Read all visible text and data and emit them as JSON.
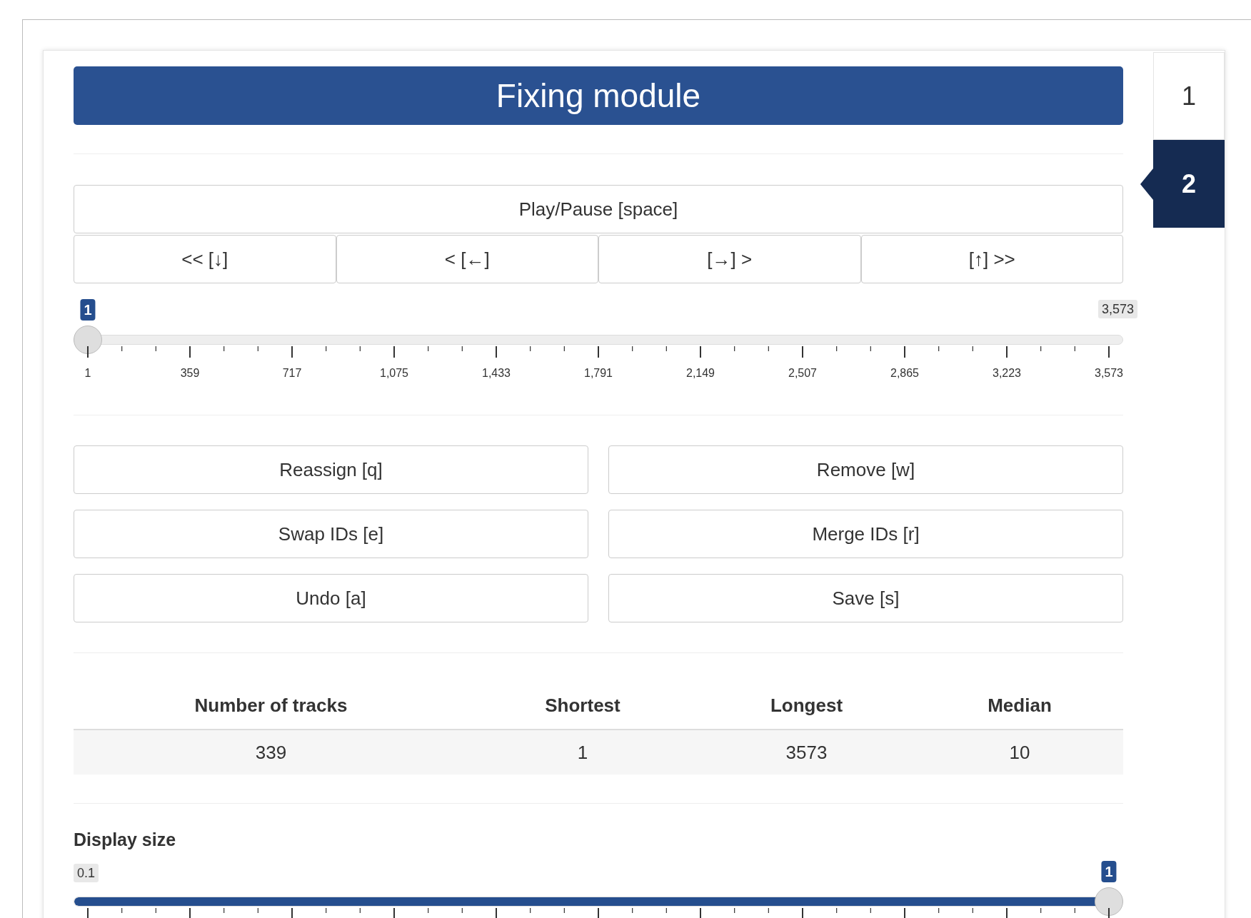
{
  "header": {
    "title": "Fixing module"
  },
  "tabs": [
    {
      "label": "1",
      "selected": false
    },
    {
      "label": "2",
      "selected": true
    }
  ],
  "playback": {
    "play_button": "Play/Pause [space]",
    "nav_buttons": [
      "<< [↓]",
      "< [←]",
      "[→] >",
      "[↑] >>"
    ]
  },
  "frame_slider": {
    "value_badge": "1",
    "max_badge": "3,573",
    "level": 0,
    "tick_labels": [
      "1",
      "359",
      "717",
      "1,075",
      "1,433",
      "1,791",
      "2,149",
      "2,507",
      "2,865",
      "3,223",
      "3,573"
    ]
  },
  "actions": [
    "Reassign [q]",
    "Remove [w]",
    "Swap IDs [e]",
    "Merge IDs [r]",
    "Undo [a]",
    "Save [s]"
  ],
  "stats": {
    "columns": [
      "Number of tracks",
      "Shortest",
      "Longest",
      "Median"
    ],
    "rows": [
      [
        "339",
        "1",
        "3573",
        "10"
      ]
    ]
  },
  "display_size": {
    "label": "Display size",
    "min_badge": "0.1",
    "value_badge": "1",
    "level": 1
  }
}
